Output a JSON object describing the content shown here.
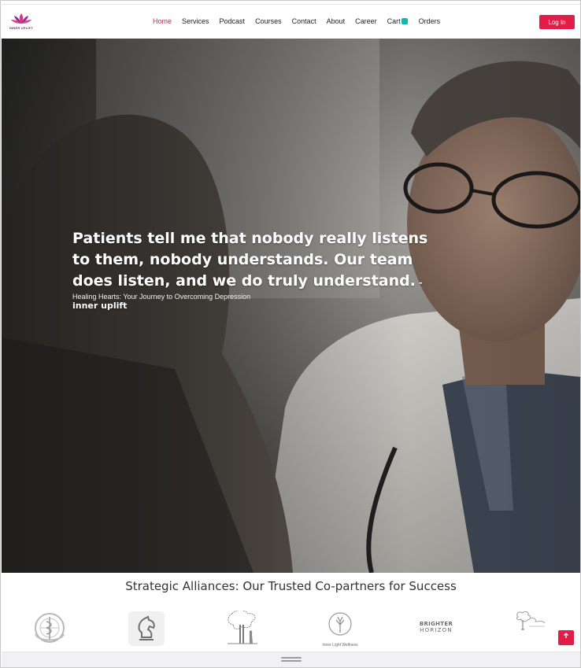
{
  "brand": {
    "logo_text": "INNER UPLIFT",
    "accent_color": "#e11d48",
    "cart_badge_color": "#10b8b0"
  },
  "nav": {
    "items": [
      {
        "label": "Home",
        "active": true
      },
      {
        "label": "Services"
      },
      {
        "label": "Podcast"
      },
      {
        "label": "Courses"
      },
      {
        "label": "Contact"
      },
      {
        "label": "About"
      },
      {
        "label": "Career"
      },
      {
        "label": "Cart"
      },
      {
        "label": "Orders"
      }
    ],
    "login_label": "Log In"
  },
  "hero": {
    "quote": "Patients tell me that nobody really listens to them, nobody understands. Our team does listen, and we do truly understand.",
    "author": "-inner uplift",
    "subtitle": "Healing Hearts: Your Journey to Overcoming Depression"
  },
  "partners": {
    "title": "Strategic Alliances: Our Trusted Co-partners for Success",
    "logos": [
      {
        "name": "who-emblem-logo"
      },
      {
        "name": "chess-knight-logo"
      },
      {
        "name": "tree-figure-logo"
      },
      {
        "name": "tree-circle-wellness-logo",
        "label": "Inner Light Wellness"
      },
      {
        "name": "brighter-horizon-logo",
        "line1": "BRIGHTER",
        "line2": "HORIZON"
      },
      {
        "name": "tree-script-logo"
      }
    ]
  },
  "scroll_top": {
    "icon": "arrow-up-icon"
  }
}
